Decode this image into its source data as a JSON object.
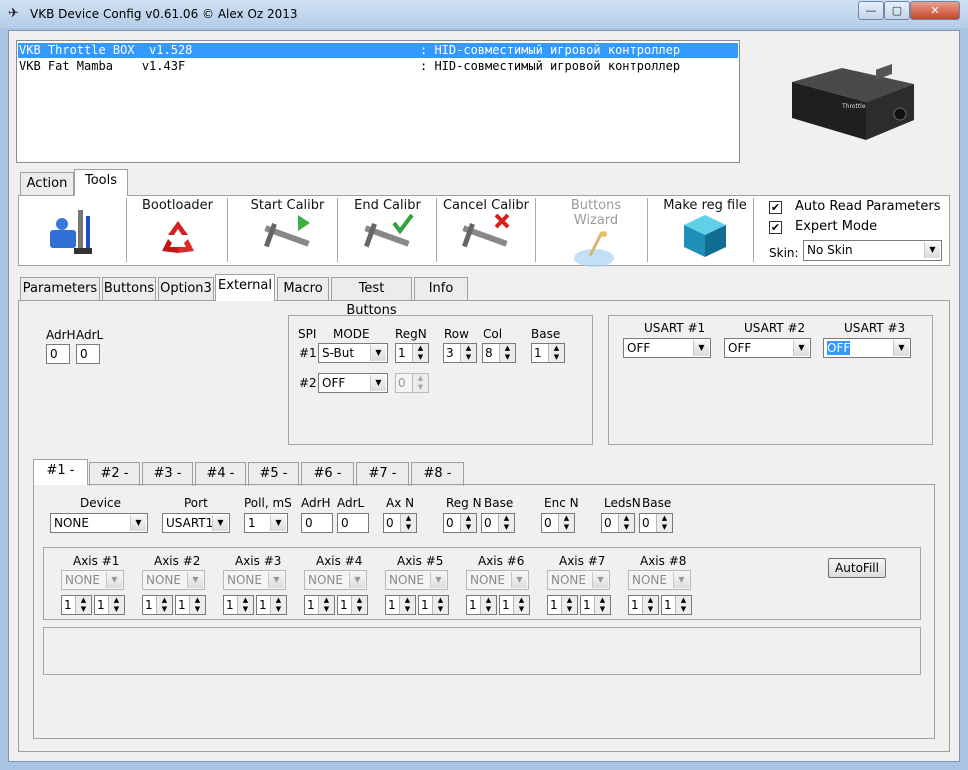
{
  "window": {
    "title": "VKB Device Config v0.61.06 © Alex Oz 2013",
    "min": "—",
    "max": "▢",
    "close": "✕"
  },
  "devices": [
    {
      "name": "VKB Throttle BOX  v1.528",
      "type": ": HID-совместимый игровой контроллер"
    },
    {
      "name": "VKB Fat Mamba    v1.43F",
      "type": ": HID-совместимый игровой контроллер"
    }
  ],
  "device_image_label": "Throttle",
  "main_tabs": [
    "Action",
    "Tools"
  ],
  "toolbar": {
    "bootloader": "Bootloader",
    "start_calibr": "Start Calibr",
    "end_calibr": "End Calibr",
    "cancel_calibr": "Cancel Calibr",
    "buttons_wizard": "Buttons Wizard",
    "make_reg_file": "Make reg file",
    "auto_read": "Auto Read Parameters",
    "expert_mode": "Expert Mode",
    "skin_label": "Skin:",
    "skin_value": "No Skin",
    "check": "✔"
  },
  "sub_tabs": [
    "Parameters",
    "Buttons",
    "Option3",
    "External",
    "Macro",
    "Test Buttons",
    "Info"
  ],
  "adr": {
    "adrh_label": "AdrH",
    "adrl_label": "AdrL",
    "adrh": "0",
    "adrl": "0"
  },
  "spi": {
    "headers": {
      "spi": "SPI",
      "mode": "MODE",
      "regn": "RegN",
      "row": "Row",
      "col": "Col",
      "base": "Base"
    },
    "row1": {
      "label": "#1",
      "mode": "S-But",
      "regn": "1",
      "row": "3",
      "col": "8",
      "base": "1"
    },
    "row2": {
      "label": "#2",
      "mode": "OFF",
      "regn": "0"
    }
  },
  "usart": [
    {
      "label": "USART #1",
      "value": "OFF"
    },
    {
      "label": "USART #2",
      "value": "OFF"
    },
    {
      "label": "USART #3",
      "value": "OFF"
    }
  ],
  "ext_tabs": [
    "#1 -",
    "#2 -",
    "#3 -",
    "#4 -",
    "#5 -",
    "#6 -",
    "#7 -",
    "#8 -"
  ],
  "ext": {
    "headers": {
      "device": "Device",
      "port": "Port",
      "poll": "Poll, mS",
      "adrh": "AdrH",
      "adrl": "AdrL",
      "axn": "Ax N",
      "regn": "Reg N",
      "base": "Base",
      "encn": "Enc N",
      "ledsn": "LedsN",
      "base2": "Base"
    },
    "device": "NONE",
    "port": "USART1",
    "poll": "1",
    "adrh": "0",
    "adrl": "0",
    "axn": "0",
    "regn": "0",
    "base": "0",
    "encn": "0",
    "ledsn": "0",
    "base2": "0"
  },
  "axes": [
    {
      "label": "Axis #1",
      "value": "NONE",
      "a": "1",
      "b": "1"
    },
    {
      "label": "Axis #2",
      "value": "NONE",
      "a": "1",
      "b": "1"
    },
    {
      "label": "Axis #3",
      "value": "NONE",
      "a": "1",
      "b": "1"
    },
    {
      "label": "Axis #4",
      "value": "NONE",
      "a": "1",
      "b": "1"
    },
    {
      "label": "Axis #5",
      "value": "NONE",
      "a": "1",
      "b": "1"
    },
    {
      "label": "Axis #6",
      "value": "NONE",
      "a": "1",
      "b": "1"
    },
    {
      "label": "Axis #7",
      "value": "NONE",
      "a": "1",
      "b": "1"
    },
    {
      "label": "Axis #8",
      "value": "NONE",
      "a": "1",
      "b": "1"
    }
  ],
  "autofill": "AutoFill",
  "glyphs": {
    "up": "▲",
    "down": "▼"
  }
}
